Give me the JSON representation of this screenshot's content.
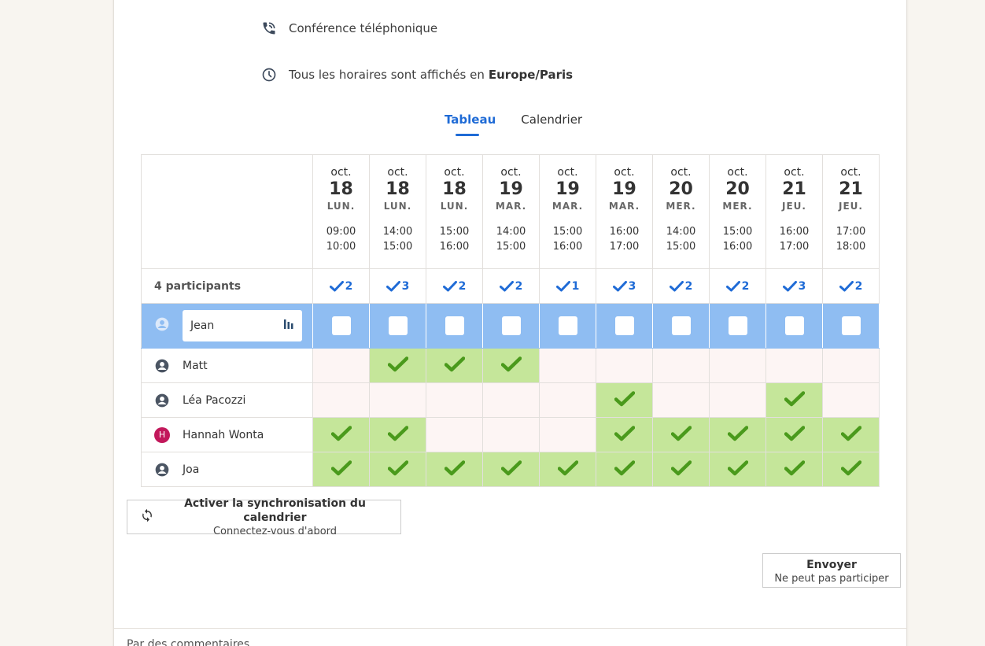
{
  "meeting": {
    "location": "Conférence téléphonique",
    "timezone_prefix": "Tous les horaires sont affichés en",
    "timezone": "Europe/Paris"
  },
  "tabs": [
    {
      "label": "Tableau",
      "active": true
    },
    {
      "label": "Calendrier",
      "active": false
    }
  ],
  "poll": {
    "participants_label": "4 participants",
    "dates": [
      {
        "month": "oct.",
        "day": "18",
        "dow": "LUN.",
        "start": "09:00",
        "end": "10:00",
        "count": "2"
      },
      {
        "month": "oct.",
        "day": "18",
        "dow": "LUN.",
        "start": "14:00",
        "end": "15:00",
        "count": "3"
      },
      {
        "month": "oct.",
        "day": "18",
        "dow": "LUN.",
        "start": "15:00",
        "end": "16:00",
        "count": "2"
      },
      {
        "month": "oct.",
        "day": "19",
        "dow": "MAR.",
        "start": "14:00",
        "end": "15:00",
        "count": "2"
      },
      {
        "month": "oct.",
        "day": "19",
        "dow": "MAR.",
        "start": "15:00",
        "end": "16:00",
        "count": "1"
      },
      {
        "month": "oct.",
        "day": "19",
        "dow": "MAR.",
        "start": "16:00",
        "end": "17:00",
        "count": "3"
      },
      {
        "month": "oct.",
        "day": "20",
        "dow": "MER.",
        "start": "14:00",
        "end": "15:00",
        "count": "2"
      },
      {
        "month": "oct.",
        "day": "20",
        "dow": "MER.",
        "start": "15:00",
        "end": "16:00",
        "count": "2"
      },
      {
        "month": "oct.",
        "day": "21",
        "dow": "JEU.",
        "start": "16:00",
        "end": "17:00",
        "count": "3"
      },
      {
        "month": "oct.",
        "day": "21",
        "dow": "JEU.",
        "start": "17:00",
        "end": "18:00",
        "count": "2"
      }
    ],
    "me": {
      "name": "Jean"
    },
    "participants": [
      {
        "name": "Matt",
        "avatar": "person-icon",
        "votes": [
          0,
          1,
          1,
          1,
          0,
          0,
          0,
          0,
          0,
          0
        ]
      },
      {
        "name": "Léa Pacozzi",
        "avatar": "person-icon",
        "votes": [
          0,
          0,
          0,
          0,
          0,
          1,
          0,
          0,
          1,
          0
        ]
      },
      {
        "name": "Hannah Wonta",
        "avatar": "H",
        "avatar_color": "#c2185b",
        "votes": [
          1,
          1,
          0,
          0,
          0,
          1,
          1,
          1,
          1,
          1
        ]
      },
      {
        "name": "Joa",
        "avatar": "person-icon",
        "votes": [
          1,
          1,
          1,
          1,
          1,
          1,
          1,
          1,
          1,
          1
        ]
      }
    ]
  },
  "sync_button": {
    "label": "Activer la synchronisation du calendrier",
    "sub": "Connectez-vous d'abord"
  },
  "send_button": {
    "label": "Envoyer",
    "sub": "Ne peut pas participer"
  },
  "footer": {
    "text": "Par des commentaires"
  },
  "colors": {
    "accent": "#1f6bd6",
    "yes": "#c5e69a",
    "no": "#fdf5f4",
    "me_row": "#8fbdf2",
    "check": "#4a9a1c"
  }
}
